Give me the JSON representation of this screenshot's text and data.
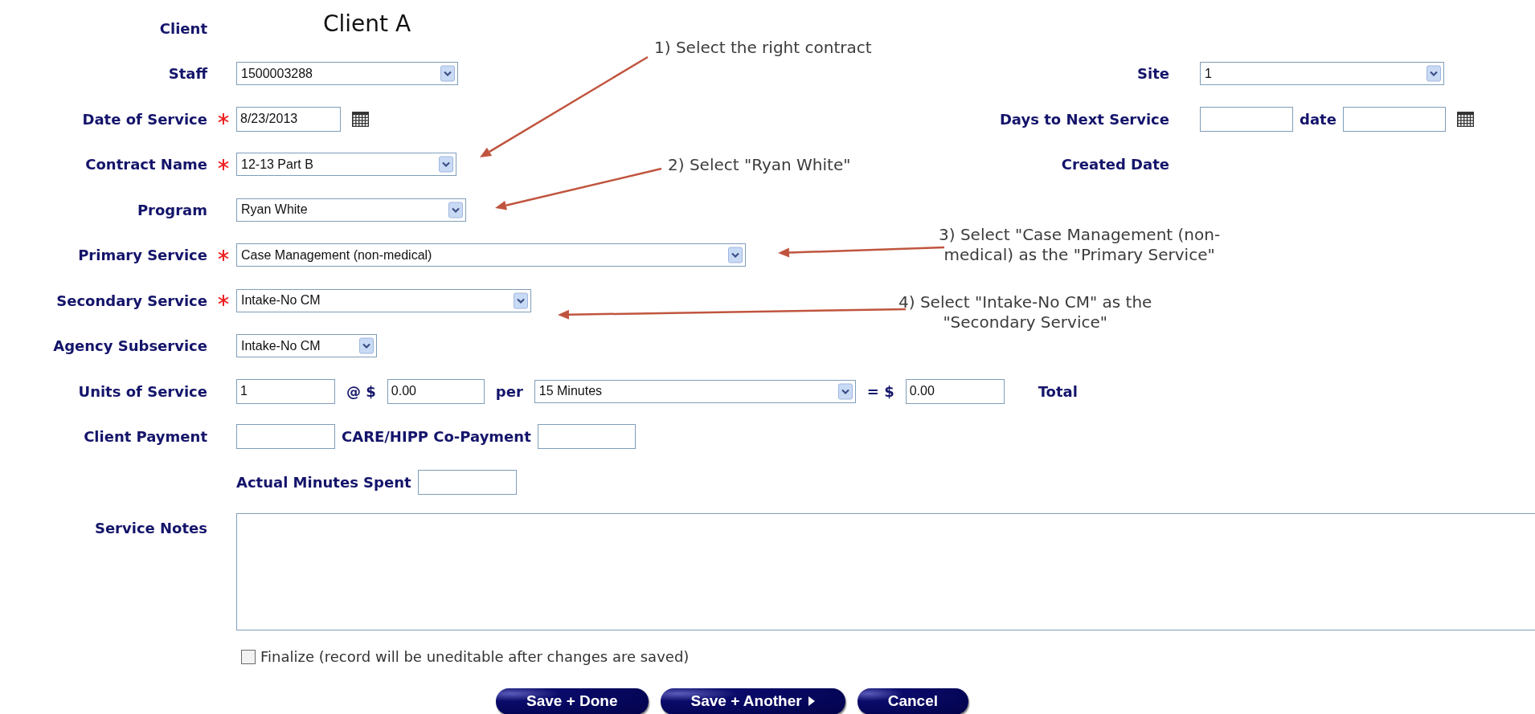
{
  "rows": [
    {
      "label": "Client",
      "controls": [
        {
          "kind": "value",
          "text": "Client A"
        }
      ]
    },
    {
      "label": "Staff",
      "controls": [
        {
          "kind": "select",
          "value": "1500003288"
        }
      ],
      "side": {
        "label": "Site",
        "controls": [
          {
            "kind": "select",
            "value": "1"
          }
        ]
      }
    },
    {
      "label": "Date of Service",
      "required": true,
      "controls": [
        {
          "kind": "input",
          "value": "8/23/2013"
        },
        {
          "kind": "calendar"
        }
      ],
      "side": {
        "label": "Days to Next Service",
        "controls": [
          {
            "kind": "input"
          },
          {
            "kind": "label",
            "text": "date"
          },
          {
            "kind": "input"
          },
          {
            "kind": "calendar"
          }
        ]
      }
    },
    {
      "label": "Contract Name",
      "required": true,
      "controls": [
        {
          "kind": "select",
          "value": "12-13 Part B"
        }
      ],
      "side": {
        "label": "Created Date"
      }
    },
    {
      "label": "Program",
      "controls": [
        {
          "kind": "select",
          "value": "Ryan White"
        }
      ]
    },
    {
      "label": "Primary Service",
      "required": true,
      "controls": [
        {
          "kind": "select",
          "value": "Case Management (non-medical)"
        }
      ]
    },
    {
      "label": "Secondary Service",
      "required": true,
      "controls": [
        {
          "kind": "select",
          "value": "Intake-No CM"
        }
      ]
    },
    {
      "label": "Agency Subservice",
      "controls": [
        {
          "kind": "select",
          "value": "Intake-No CM"
        }
      ]
    },
    {
      "label": "Units of Service",
      "controls": [
        {
          "kind": "input",
          "value": "1"
        },
        {
          "kind": "label",
          "text": "@ $"
        },
        {
          "kind": "input",
          "value": "0.00"
        },
        {
          "kind": "label",
          "text": "per"
        },
        {
          "kind": "select",
          "value": "15 Minutes"
        },
        {
          "kind": "label",
          "text": "= $"
        },
        {
          "kind": "input",
          "value": "0.00"
        },
        {
          "kind": "label",
          "text": "Total"
        }
      ]
    },
    {
      "label": "Client Payment",
      "controls": [
        {
          "kind": "input"
        },
        {
          "kind": "label",
          "text": "CARE/HIPP Co-Payment"
        },
        {
          "kind": "input"
        }
      ]
    },
    {
      "controls": [
        {
          "kind": "label",
          "text": "Actual Minutes Spent"
        },
        {
          "kind": "input"
        }
      ]
    },
    {
      "label": "Service Notes",
      "controls": [
        {
          "kind": "textarea"
        }
      ]
    }
  ],
  "finalize": {
    "label": "Finalize (record will be uneditable after changes are saved)",
    "checked": false
  },
  "buttons": [
    {
      "label": "Save + Done",
      "kind": "plain"
    },
    {
      "label": "Save + Another",
      "kind": "next"
    },
    {
      "label": "Cancel",
      "kind": "plain"
    }
  ],
  "annotations": [
    {
      "text": "1) Select the right contract"
    },
    {
      "text": "2) Select \"Ryan White\""
    },
    {
      "text": "3) Select \"Case Management (non-\nmedical) as the \"Primary Service\""
    },
    {
      "text": "4) Select \"Intake-No CM\" as the\n\"Secondary Service\""
    }
  ]
}
